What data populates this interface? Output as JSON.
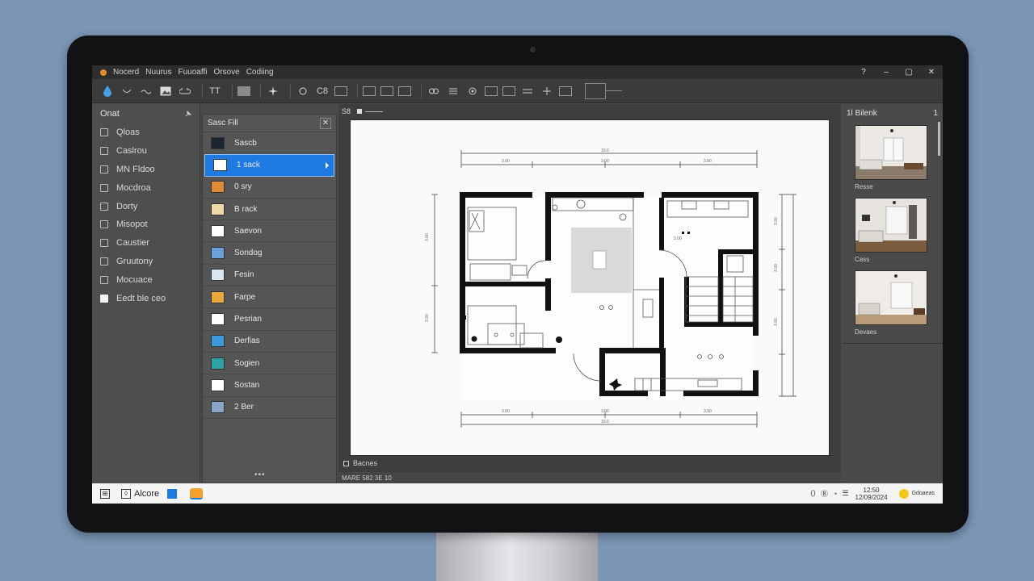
{
  "titlebar": {
    "menus": [
      "Nocerd",
      "Nuurus",
      "Fuuoaffi",
      "Orsove",
      "Codiing"
    ],
    "controls": [
      "?",
      "–",
      "▢",
      "✕"
    ]
  },
  "toolbar": {
    "labels": [
      "TT",
      "C8"
    ]
  },
  "left_panel": {
    "title": "Onat",
    "items": [
      {
        "label": "Qloas"
      },
      {
        "label": "Caslrou"
      },
      {
        "label": "MN Fldoo"
      },
      {
        "label": "Mocdroa"
      },
      {
        "label": "Dorty"
      },
      {
        "label": "Misopot"
      },
      {
        "label": "Caustier"
      },
      {
        "label": "Gruutony"
      },
      {
        "label": "Mocuace"
      },
      {
        "label": "Eedt ble ceo"
      }
    ]
  },
  "mid_panel": {
    "title": "Sasc Fill",
    "close": "✕",
    "items": [
      {
        "label": "Sascb",
        "swatch": "#1b2430"
      },
      {
        "label": "1 sack",
        "swatch": "#ffffff",
        "selected": true
      },
      {
        "label": "0 sry",
        "swatch": "#e08a38"
      },
      {
        "label": "B rack",
        "swatch": "#f0d9a8"
      },
      {
        "label": "Saevon",
        "swatch": "#ffffff"
      },
      {
        "label": "Sondog",
        "swatch": "#6ea0d8"
      },
      {
        "label": "Fesin",
        "swatch": "#d8e6f2"
      },
      {
        "label": "Farpe",
        "swatch": "#e9a93a"
      },
      {
        "label": "Pesrian",
        "swatch": "#ffffff"
      },
      {
        "label": "Derfias",
        "swatch": "#3c9ad8"
      },
      {
        "label": "Sogien",
        "swatch": "#2fa3a3"
      },
      {
        "label": "Sostan",
        "swatch": "#ffffff"
      },
      {
        "label": "2 Ber",
        "swatch": "#8aa3c8"
      }
    ],
    "more": "•••"
  },
  "canvas": {
    "tab_label": "S8",
    "status_label": "Bacnes",
    "bottom_label": "MARE 582 3E 10"
  },
  "right_panel": {
    "title": "1l Bilenk",
    "badge": "1",
    "thumbs": [
      {
        "label": "Resse"
      },
      {
        "label": "Cass"
      },
      {
        "label": "Devaes"
      }
    ]
  },
  "taskbar": {
    "app_label": "Alcore",
    "tray_clock": "12:50",
    "tray_date": "12/09/2024",
    "tray_label": "Gdoaeas"
  },
  "colors": {
    "accent": "#1e7ae0",
    "wall": "#111111",
    "paper": "#fafafa"
  }
}
